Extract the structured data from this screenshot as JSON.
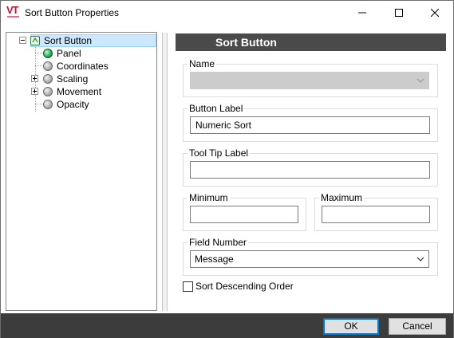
{
  "window": {
    "title": "Sort Button Properties",
    "logo_text": "VT"
  },
  "tree": {
    "items": [
      {
        "label": "Sort Button",
        "icon": "node-icon",
        "expander": "minus",
        "selected": true
      },
      {
        "label": "Panel",
        "icon": "green-dot-icon"
      },
      {
        "label": "Coordinates",
        "icon": "gray-dot-icon"
      },
      {
        "label": "Scaling",
        "icon": "gray-dot-icon",
        "expander": "plus"
      },
      {
        "label": "Movement",
        "icon": "gray-dot-icon",
        "expander": "plus"
      },
      {
        "label": "Opacity",
        "icon": "gray-dot-icon"
      }
    ]
  },
  "panel": {
    "header": "Sort Button",
    "name": {
      "label": "Name",
      "value": ""
    },
    "button_label": {
      "label": "Button Label",
      "value": "Numeric Sort"
    },
    "tooltip_label": {
      "label": "Tool Tip Label",
      "value": ""
    },
    "minimum": {
      "label": "Minimum",
      "value": ""
    },
    "maximum": {
      "label": "Maximum",
      "value": ""
    },
    "field_number": {
      "label": "Field Number",
      "value": "Message"
    },
    "sort_descending": {
      "label": "Sort Descending Order",
      "checked": false
    }
  },
  "buttons": {
    "ok": "OK",
    "cancel": "Cancel"
  },
  "colors": {
    "header_bg": "#4a4a4a",
    "bottom_bar_bg": "#3c3c3c",
    "selection_bg": "#cce8ff",
    "default_button_border": "#0078d7",
    "logo_red": "#c8102e"
  }
}
